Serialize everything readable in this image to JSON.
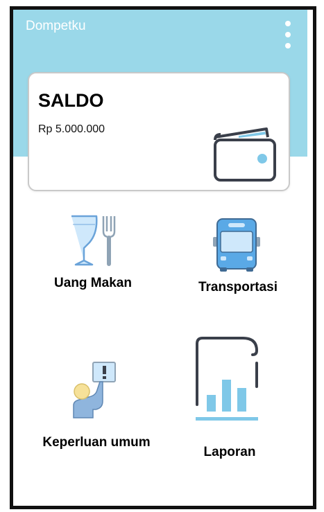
{
  "app": {
    "title": "Dompetku"
  },
  "balance": {
    "heading": "SALDO",
    "amount": "Rp 5.000.000"
  },
  "menu": [
    {
      "label": "Uang Makan",
      "icon": "food-icon"
    },
    {
      "label": "Transportasi",
      "icon": "bus-icon"
    },
    {
      "label": "Keperluan umum",
      "icon": "general-needs-icon"
    },
    {
      "label": "Laporan",
      "icon": "report-icon"
    }
  ],
  "colors": {
    "header": "#9ad8e9",
    "accent_blue": "#5aa9e6",
    "light_blue": "#cfe8fb"
  }
}
